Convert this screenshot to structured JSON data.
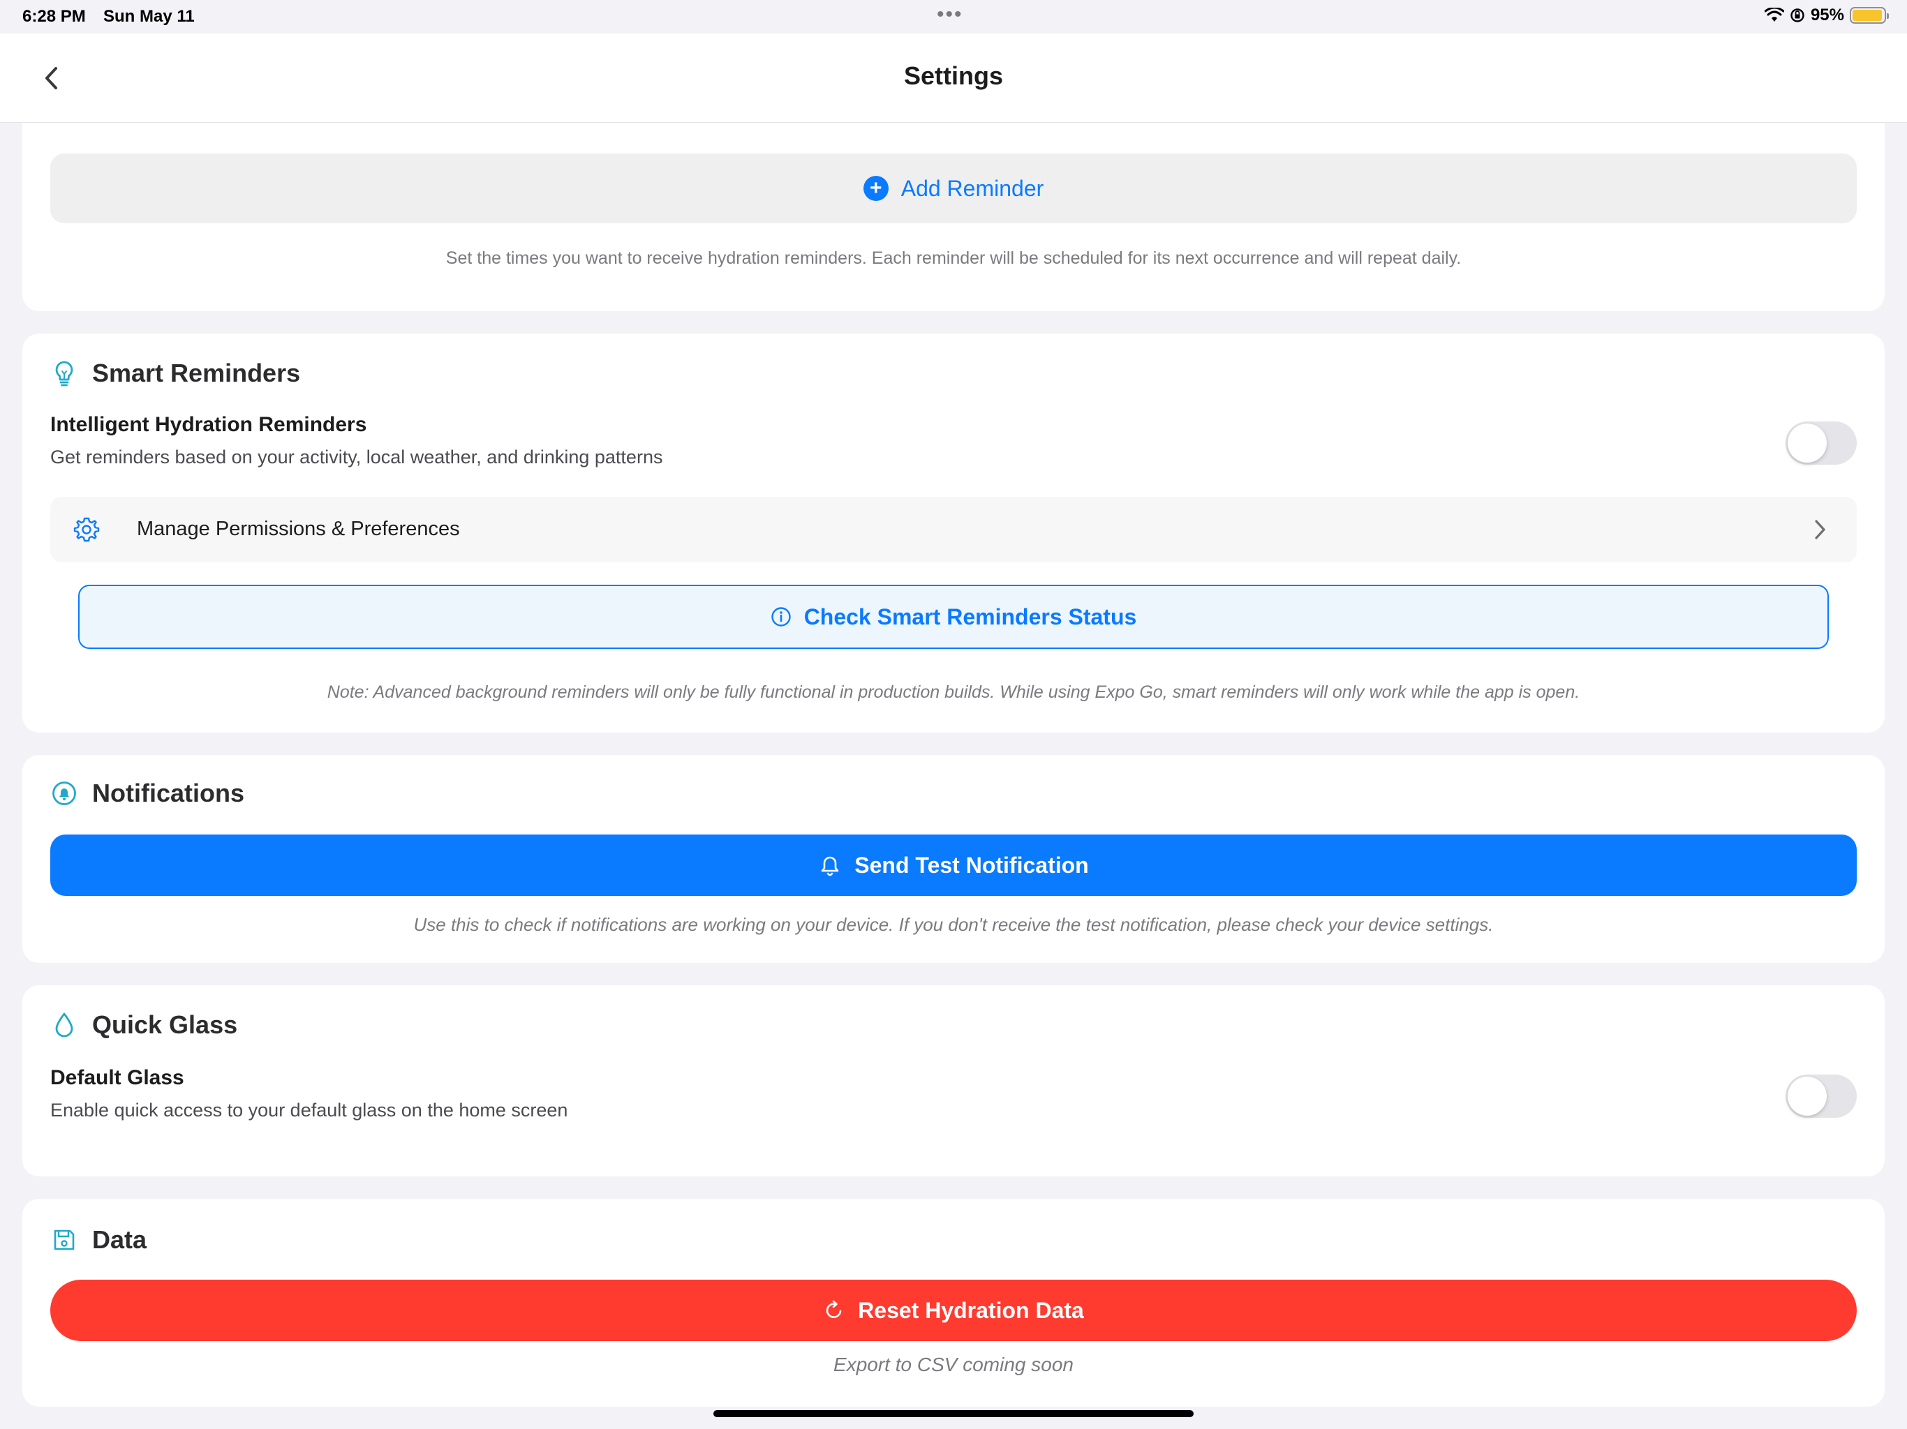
{
  "status_bar": {
    "time": "6:28 PM",
    "date": "Sun May 11",
    "battery_percent": "95%",
    "battery_level": 0.95,
    "battery_color": "#f7c52b"
  },
  "nav": {
    "title": "Settings",
    "back_icon": "chevron-left-icon"
  },
  "reminders": {
    "add_label": "Add Reminder",
    "add_icon": "plus-circle-icon",
    "helper": "Set the times you want to receive hydration reminders. Each reminder will be scheduled for its next occurrence and will repeat daily."
  },
  "smart_reminders": {
    "title": "Smart Reminders",
    "icon": "lightbulb-icon",
    "toggle_title": "Intelligent Hydration Reminders",
    "toggle_subtitle": "Get reminders based on your activity, local weather, and drinking patterns",
    "toggle_on": false,
    "manage_label": "Manage Permissions & Preferences",
    "manage_icon": "gear-icon",
    "check_status_label": "Check Smart Reminders Status",
    "check_status_icon": "info-icon",
    "note": "Note: Advanced background reminders will only be fully functional in production builds. While using Expo Go, smart reminders will only work while the app is open."
  },
  "notifications": {
    "title": "Notifications",
    "icon": "notification-badge-icon",
    "test_label": "Send Test Notification",
    "test_icon": "bell-icon",
    "helper": "Use this to check if notifications are working on your device. If you don't receive the test notification, please check your device settings."
  },
  "quick_glass": {
    "title": "Quick Glass",
    "icon": "water-drop-icon",
    "toggle_title": "Default Glass",
    "toggle_subtitle": "Enable quick access to your default glass on the home screen",
    "toggle_on": false
  },
  "data_section": {
    "title": "Data",
    "icon": "save-icon",
    "reset_label": "Reset Hydration Data",
    "reset_icon": "refresh-icon",
    "export_note": "Export to CSV coming soon"
  },
  "colors": {
    "accent": "#0a7aff",
    "teal_icon": "#20a9c9",
    "danger": "#ff3b30",
    "background": "#f2f2f7"
  }
}
